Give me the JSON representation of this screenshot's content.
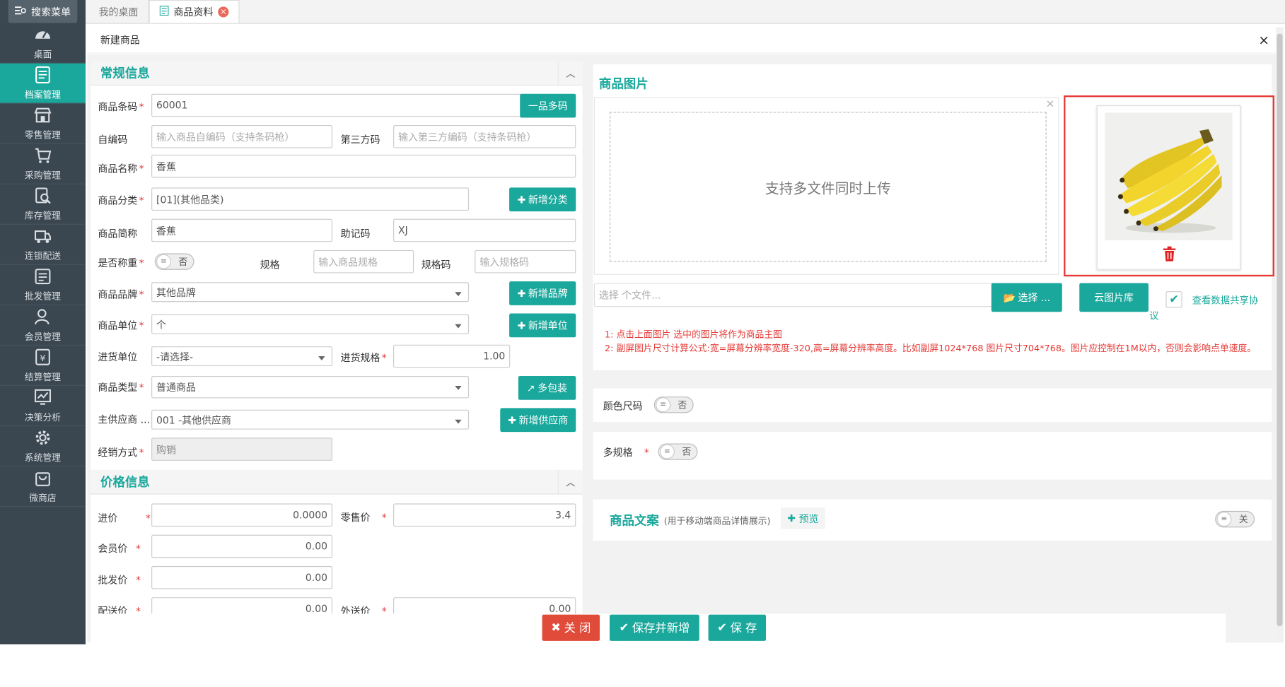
{
  "sidebar": {
    "search_label": "搜索菜单",
    "items": [
      {
        "label": "桌面",
        "icon": "dashboard-icon"
      },
      {
        "label": "档案管理",
        "icon": "archive-icon"
      },
      {
        "label": "零售管理",
        "icon": "store-icon"
      },
      {
        "label": "采购管理",
        "icon": "cart-icon"
      },
      {
        "label": "库存管理",
        "icon": "inventory-search-icon"
      },
      {
        "label": "连锁配送",
        "icon": "truck-icon"
      },
      {
        "label": "批发管理",
        "icon": "wholesale-icon"
      },
      {
        "label": "会员管理",
        "icon": "member-icon"
      },
      {
        "label": "结算管理",
        "icon": "settlement-icon"
      },
      {
        "label": "决策分析",
        "icon": "chart-icon"
      },
      {
        "label": "系统管理",
        "icon": "gear-icon"
      },
      {
        "label": "微商店",
        "icon": "shop-bag-icon"
      }
    ],
    "active_index": 1
  },
  "tabs": [
    {
      "label": "我的桌面"
    },
    {
      "label": "商品资料"
    }
  ],
  "modal": {
    "title": "新建商品",
    "close": "×"
  },
  "general": {
    "title": "常规信息",
    "barcode": {
      "label": "商品条码",
      "value": "60001",
      "button": "一品多码"
    },
    "self_code": {
      "label": "自编码",
      "placeholder": "输入商品自编码（支持条码枪）"
    },
    "third_code": {
      "label": "第三方码",
      "placeholder": "输入第三方编码（支持条码枪）"
    },
    "name": {
      "label": "商品名称",
      "value": "香蕉"
    },
    "category": {
      "label": "商品分类",
      "value": "[01](其他品类)",
      "button": "新增分类"
    },
    "short_name": {
      "label": "商品简称",
      "value": "香蕉"
    },
    "mnemonic": {
      "label": "助记码",
      "value": "XJ"
    },
    "weighing": {
      "label": "是否称重",
      "toggle": "否"
    },
    "spec": {
      "label": "规格",
      "placeholder": "输入商品规格"
    },
    "spec_code": {
      "label": "规格码",
      "placeholder": "输入规格码"
    },
    "brand": {
      "label": "商品品牌",
      "value": "其他品牌",
      "button": "新增品牌"
    },
    "unit": {
      "label": "商品单位",
      "value": "个",
      "button": "新增单位"
    },
    "purchase_unit": {
      "label": "进货单位",
      "value": "-请选择-"
    },
    "purchase_spec": {
      "label": "进货规格",
      "value": "1.00"
    },
    "type": {
      "label": "商品类型",
      "value": "普通商品",
      "button": "多包装"
    },
    "supplier": {
      "label": "主供应商 ...",
      "value": "001 -其他供应商",
      "button": "新增供应商"
    },
    "sales_mode": {
      "label": "经销方式",
      "value": "购销"
    }
  },
  "price": {
    "title": "价格信息",
    "cost": {
      "label": "进价",
      "value": "0.0000"
    },
    "retail": {
      "label": "零售价",
      "value": "3.4"
    },
    "member": {
      "label": "会员价",
      "value": "0.00"
    },
    "wholesale": {
      "label": "批发价",
      "value": "0.00"
    },
    "delivery": {
      "label": "配送价",
      "value": "0.00"
    },
    "outside": {
      "label": "外送价",
      "value": "0.00"
    }
  },
  "images": {
    "title": "商品图片",
    "dropzone_text": "支持多文件同时上传",
    "dropzone_close": "×",
    "file_placeholder": "选择 个文件...",
    "select_button": "选择 ...",
    "cloud_button": "云图片库",
    "share_label": "查看数据共享协",
    "share_label_wrap": "议",
    "share_checked": true,
    "notes": [
      "1: 点击上面图片 选中的图片将作为商品主图",
      "2: 副屏图片尺寸计算公式:宽=屏幕分辨率宽度-320,高=屏幕分辨率高度。比如副屏1024*768 图片尺寸704*768。图片应控制在1M以内，否则会影响点单速度。"
    ]
  },
  "color_size": {
    "label": "颜色尺码",
    "toggle": "否"
  },
  "multi_spec": {
    "label": "多规格",
    "toggle": "否"
  },
  "copywriting": {
    "title": "商品文案",
    "subtitle": "(用于移动端商品详情展示)",
    "preview": "预览",
    "toggle": "关"
  },
  "footer": {
    "close": "关 闭",
    "save_new": "保存并新增",
    "save": "保 存"
  },
  "colors": {
    "accent": "#1aa89c",
    "danger": "#e04b3a",
    "sidebar": "#3a4650"
  }
}
